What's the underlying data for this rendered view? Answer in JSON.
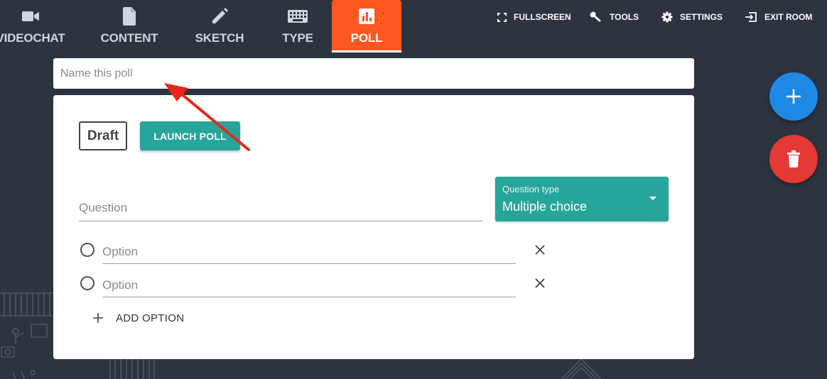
{
  "nav": {
    "tabs": [
      {
        "label": "VIDEOCHAT",
        "icon": "video-camera-icon"
      },
      {
        "label": "CONTENT",
        "icon": "document-icon"
      },
      {
        "label": "SKETCH",
        "icon": "pencil-icon"
      },
      {
        "label": "TYPE",
        "icon": "keyboard-icon"
      },
      {
        "label": "POLL",
        "icon": "poll-chart-icon",
        "active": true
      }
    ],
    "actions": [
      {
        "label": "FULLSCREEN",
        "icon": "fullscreen-icon"
      },
      {
        "label": "TOOLS",
        "icon": "wrench-icon"
      },
      {
        "label": "SETTINGS",
        "icon": "gear-icon"
      },
      {
        "label": "EXIT ROOM",
        "icon": "exit-icon"
      }
    ]
  },
  "poll": {
    "name_placeholder": "Name this poll",
    "status": "Draft",
    "launch_label": "LAUNCH POLL",
    "question_placeholder": "Question",
    "question_type_label": "Question type",
    "question_type_value": "Multiple choice",
    "options": [
      {
        "placeholder": "Option"
      },
      {
        "placeholder": "Option"
      }
    ],
    "add_option_label": "ADD OPTION"
  },
  "colors": {
    "background": "#2d3440",
    "active_tab": "#ff5722",
    "teal": "#26a69a",
    "fab_add": "#1e88e5",
    "fab_delete": "#e53935",
    "annotation_arrow": "#e8261c"
  },
  "fabs": [
    {
      "icon": "plus-icon"
    },
    {
      "icon": "trash-icon"
    }
  ]
}
